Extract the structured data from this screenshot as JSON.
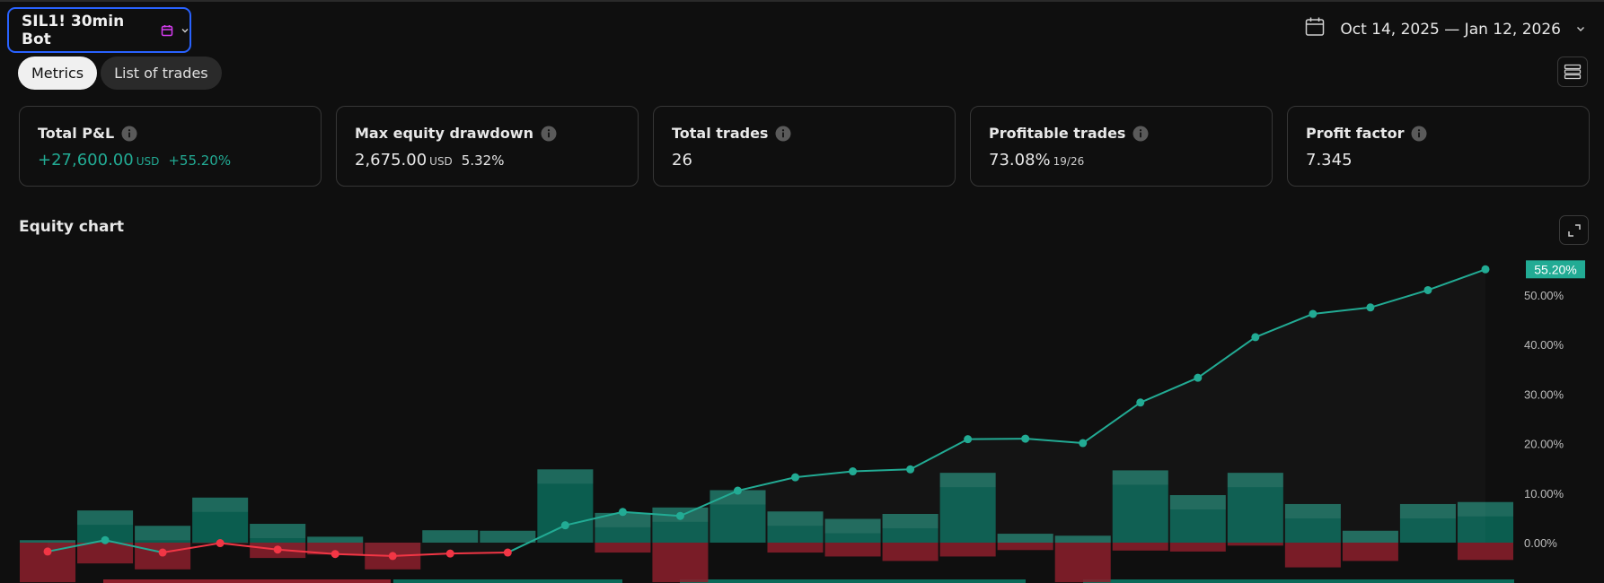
{
  "header": {
    "strategy_label": "SIL1! 30min Bot",
    "date_range": "Oct 14, 2025 — Jan 12, 2026",
    "icons": [
      "calendar-icon",
      "chevron-down-icon",
      "layout-list-icon",
      "info-icon",
      "expand-icon"
    ]
  },
  "tabs": [
    {
      "label": "Metrics",
      "active": true
    },
    {
      "label": "List of trades",
      "active": false
    }
  ],
  "metrics": {
    "total_pnl": {
      "title": "Total P&L",
      "value": "+27,600.00",
      "unit": "USD",
      "pct": "+55.20%"
    },
    "max_drawdown": {
      "title": "Max equity drawdown",
      "value": "2,675.00",
      "unit": "USD",
      "pct": "5.32%"
    },
    "total_trades": {
      "title": "Total trades",
      "value": "26"
    },
    "profitable_trades": {
      "title": "Profitable trades",
      "value": "73.08%",
      "ratio": "19/26"
    },
    "profit_factor": {
      "title": "Profit factor",
      "value": "7.345"
    }
  },
  "equity_section": {
    "title": "Equity chart"
  },
  "colors": {
    "background": "#0f0f0f",
    "accent_blue": "#2962ff",
    "positive": "#22ab94",
    "negative": "#f23645",
    "bar_positive": "#0b6b5a",
    "bar_negative": "#8c1f2b"
  },
  "chart_data": {
    "type": "line",
    "y_unit": "%",
    "ylim": [
      -5,
      55.2
    ],
    "yticks": [
      "0.00%",
      "10.00%",
      "20.00%",
      "30.00%",
      "40.00%",
      "50.00%"
    ],
    "ytick_values": [
      0,
      10,
      20,
      30,
      40,
      50
    ],
    "last_value_label": "55.20%",
    "series": [
      {
        "values": [
          -1.8,
          0.5,
          -2.0,
          -0.1,
          -1.4,
          -2.3,
          -2.7,
          -2.2,
          -2.0,
          3.5,
          6.2,
          5.4,
          10.5,
          13.2,
          14.4,
          14.8,
          20.9,
          21.0,
          20.1,
          28.3,
          33.3,
          41.5,
          46.2,
          47.5,
          51.0,
          55.2
        ]
      }
    ],
    "bars": [
      {
        "run_up": 0.5,
        "drawdown": -8
      },
      {
        "run_up": 6.5,
        "drawdown": -4.2
      },
      {
        "run_up": 3.4,
        "drawdown": -5.4
      },
      {
        "run_up": 9.1,
        "drawdown": -0.1
      },
      {
        "run_up": 3.8,
        "drawdown": -3.1
      },
      {
        "run_up": 1.2,
        "drawdown": -2.4
      },
      {
        "run_up": 0,
        "drawdown": -5.4
      },
      {
        "run_up": 2.5,
        "drawdown": 0
      },
      {
        "run_up": 2.4,
        "drawdown": 0
      },
      {
        "run_up": 14.8,
        "drawdown": 0
      },
      {
        "run_up": 6.0,
        "drawdown": -2.0
      },
      {
        "run_up": 7.1,
        "drawdown": -8
      },
      {
        "run_up": 10.6,
        "drawdown": 0
      },
      {
        "run_up": 6.3,
        "drawdown": -2.0
      },
      {
        "run_up": 4.8,
        "drawdown": -2.8
      },
      {
        "run_up": 5.8,
        "drawdown": -3.7
      },
      {
        "run_up": 14.1,
        "drawdown": -2.8
      },
      {
        "run_up": 1.8,
        "drawdown": -1.5
      },
      {
        "run_up": 1.4,
        "drawdown": -8
      },
      {
        "run_up": 14.6,
        "drawdown": -1.6
      },
      {
        "run_up": 9.6,
        "drawdown": -1.8
      },
      {
        "run_up": 14.1,
        "drawdown": -0.6
      },
      {
        "run_up": 7.8,
        "drawdown": -5.0
      },
      {
        "run_up": 2.4,
        "drawdown": -3.7
      },
      {
        "run_up": 7.8,
        "drawdown": 0
      },
      {
        "run_up": 8.2,
        "drawdown": -3.5
      }
    ]
  }
}
